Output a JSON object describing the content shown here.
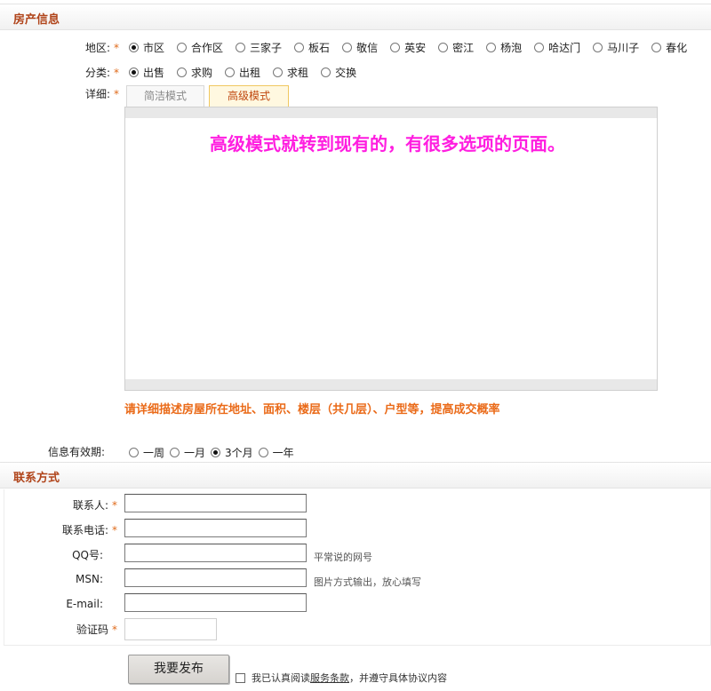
{
  "property_section": {
    "title": "房产信息"
  },
  "district": {
    "label": "地区:",
    "options": [
      "市区",
      "合作区",
      "三家子",
      "板石",
      "敬信",
      "英安",
      "密江",
      "杨泡",
      "哈达门",
      "马川子",
      "春化"
    ],
    "selected": "市区"
  },
  "category": {
    "label": "分类:",
    "options": [
      "出售",
      "求购",
      "出租",
      "求租",
      "交换"
    ],
    "selected": "出售"
  },
  "detail": {
    "label": "详细:",
    "tabs": {
      "simple": "简洁模式",
      "advanced": "高级模式"
    },
    "active_tab": "advanced",
    "annotation": "高级模式就转到现有的，有很多选项的页面。",
    "hint": "请详细描述房屋所在地址、面积、楼层（共几层）、户型等，提高成交概率"
  },
  "validity": {
    "label": "信息有效期:",
    "options": [
      "一周",
      "一月",
      "3个月",
      "一年"
    ],
    "selected": "3个月"
  },
  "contact_section": {
    "title": "联系方式"
  },
  "contact": {
    "name_label": "联系人:",
    "name_value": "",
    "phone_label": "联系电话:",
    "phone_value": "",
    "qq_label": "QQ号:",
    "qq_value": "",
    "qq_hint": "平常说的网号",
    "msn_label": "MSN:",
    "msn_value": "",
    "msn_hint": "图片方式输出，放心填写",
    "email_label": "E-mail:",
    "email_value": "",
    "captcha_label": "验证码"
  },
  "submit": {
    "label": "我要发布"
  },
  "agreement": {
    "prefix": "我已认真阅读",
    "link": "服务条款",
    "suffix": "，并遵守具体协议内容",
    "checked": false
  },
  "colors": {
    "section_title": "#b0441a",
    "required_star": "#e06a1a",
    "annotation": "#ff1ee0",
    "hint": "#ea6a18"
  }
}
